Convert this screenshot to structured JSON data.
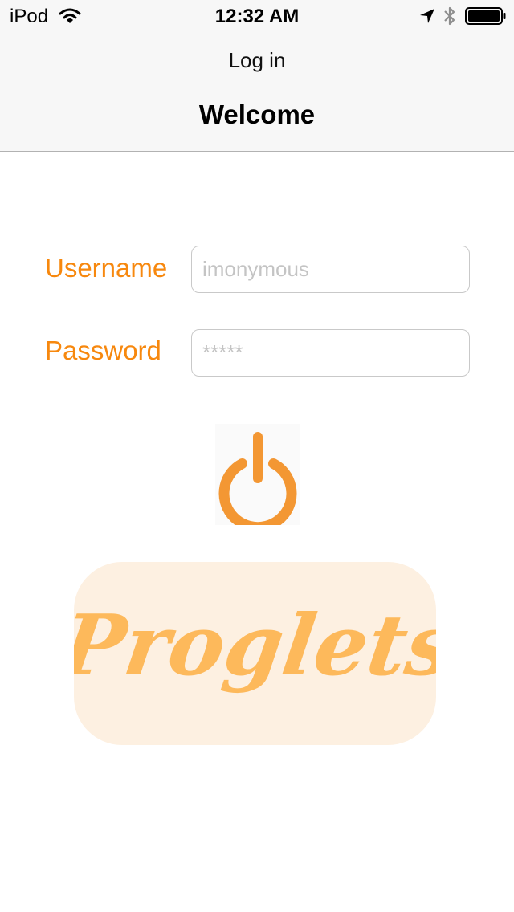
{
  "status_bar": {
    "carrier": "iPod",
    "time": "12:32 AM",
    "icons": [
      "wifi-icon",
      "location-icon",
      "bluetooth-icon",
      "battery-icon"
    ]
  },
  "nav": {
    "title": "Log in"
  },
  "page": {
    "title": "Welcome"
  },
  "form": {
    "username_label": "Username",
    "username_placeholder": "imonymous",
    "password_label": "Password",
    "password_placeholder": "*****"
  },
  "login_icon": "power-icon",
  "logo": {
    "text": "Proglets"
  },
  "colors": {
    "accent": "#f7880e",
    "power_icon": "#f39733",
    "logo_text": "#fdb95b",
    "logo_background": "#fdf0e1",
    "header_background": "#f7f7f7"
  }
}
